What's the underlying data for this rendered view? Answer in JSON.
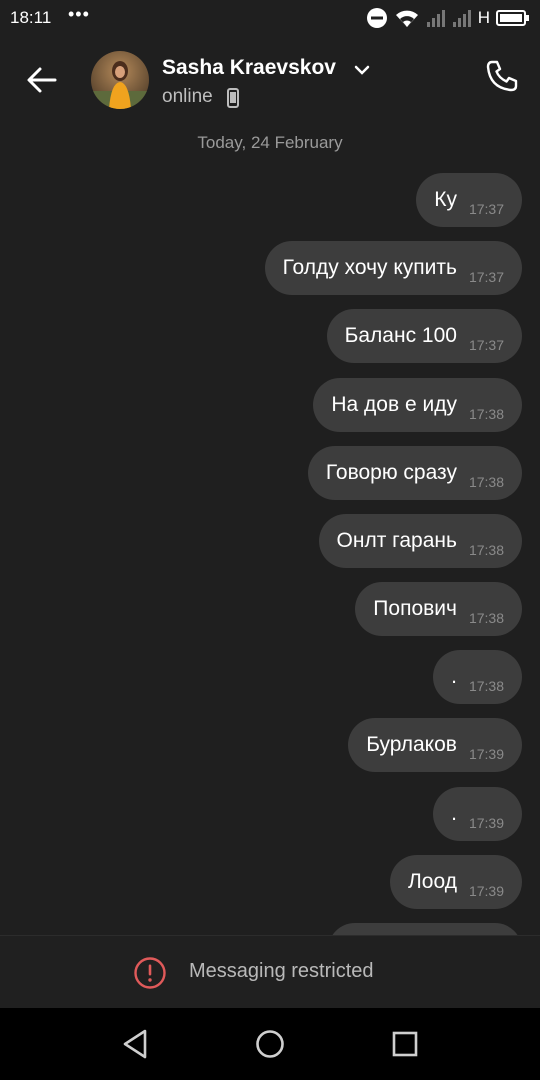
{
  "status_bar": {
    "time": "18:11",
    "dots": "•••",
    "network_label": "H"
  },
  "header": {
    "contact_name": "Sasha Kraevskov",
    "contact_status": "online"
  },
  "chat": {
    "date_separator": "Today, 24 February",
    "messages": [
      {
        "text": "Ку",
        "time": "17:37"
      },
      {
        "text": "Голду хочу купить",
        "time": "17:37"
      },
      {
        "text": "Баланс 100",
        "time": "17:37"
      },
      {
        "text": "На дов е иду",
        "time": "17:38"
      },
      {
        "text": "Говорю сразу",
        "time": "17:38"
      },
      {
        "text": "Онлт гарань",
        "time": "17:38"
      },
      {
        "text": "Попович",
        "time": "17:38"
      },
      {
        "text": ".",
        "time": "17:38"
      },
      {
        "text": "Бурлаков",
        "time": "17:39"
      },
      {
        "text": ".",
        "time": "17:39"
      },
      {
        "text": "Лоод",
        "time": "17:39"
      }
    ]
  },
  "restricted_bar": {
    "label": "Messaging restricted"
  },
  "colors": {
    "background": "#1f1f1f",
    "bubble": "#3d3d3d",
    "warning": "#e05a5a"
  },
  "icons": [
    "back-arrow-icon",
    "chevron-down-icon",
    "phone-icon",
    "mobile-device-icon",
    "warning-icon",
    "nav-back-icon",
    "nav-home-icon",
    "nav-recents-icon"
  ]
}
